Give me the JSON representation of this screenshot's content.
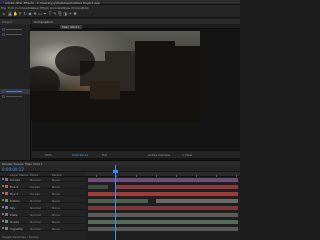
{
  "window": {
    "title": "Adobe After Effects - C:\\Users\\yyy\\Desktop\\Untitled Project.aep",
    "menus": [
      "File",
      "Edit",
      "Composition",
      "Layer",
      "Effect",
      "Animation",
      "View",
      "Window",
      "Help"
    ]
  },
  "toolbar": {
    "tools": [
      "home-icon",
      "selection-icon",
      "hand-icon",
      "zoom-icon",
      "rotate-icon",
      "camera-icon",
      "pan-behind-icon",
      "rectangle-icon",
      "pen-icon",
      "text-icon",
      "brush-icon",
      "clone-icon",
      "eraser-icon",
      "roto-icon",
      "puppet-icon"
    ]
  },
  "project_panel": {
    "tab": "Project"
  },
  "viewer": {
    "tab": "Composition",
    "comp_tab": "Main Shot 1",
    "label": "Active Camera",
    "zoom": "50%",
    "timecode": "0:00:00:12",
    "resolution": "Full",
    "view": "Active Camera",
    "views": "1 View"
  },
  "timeline": {
    "tab": "Main Shot 1",
    "render_queue": "Render Queue",
    "timecode": "0:00:00:12",
    "columns": {
      "name": "Layer Name",
      "mode": "Mode",
      "parent": "Parent"
    },
    "layers": [
      {
        "name": "Smoke",
        "mode": "Normal",
        "parent": "None",
        "color": "#8a5c9b"
      },
      {
        "name": "Fire 2",
        "mode": "Screen",
        "parent": "None",
        "color": "#c45a5a"
      },
      {
        "name": "Fire 1",
        "mode": "Screen",
        "parent": "None",
        "color": "#c45a5a"
      },
      {
        "name": "Debris",
        "mode": "Normal",
        "parent": "None",
        "color": "#6e8a6e"
      },
      {
        "name": "Sky",
        "mode": "Normal",
        "parent": "None",
        "color": "#5a7ab5"
      },
      {
        "name": "Plate",
        "mode": "Normal",
        "parent": "None",
        "color": "#7a7a7a"
      },
      {
        "name": "Grade",
        "mode": "Normal",
        "parent": "None",
        "color": "#6e8a6e"
      },
      {
        "name": "Vignette",
        "mode": "Normal",
        "parent": "None",
        "color": "#7a7a7a"
      }
    ],
    "footer": "Toggle Switches / Modes"
  }
}
